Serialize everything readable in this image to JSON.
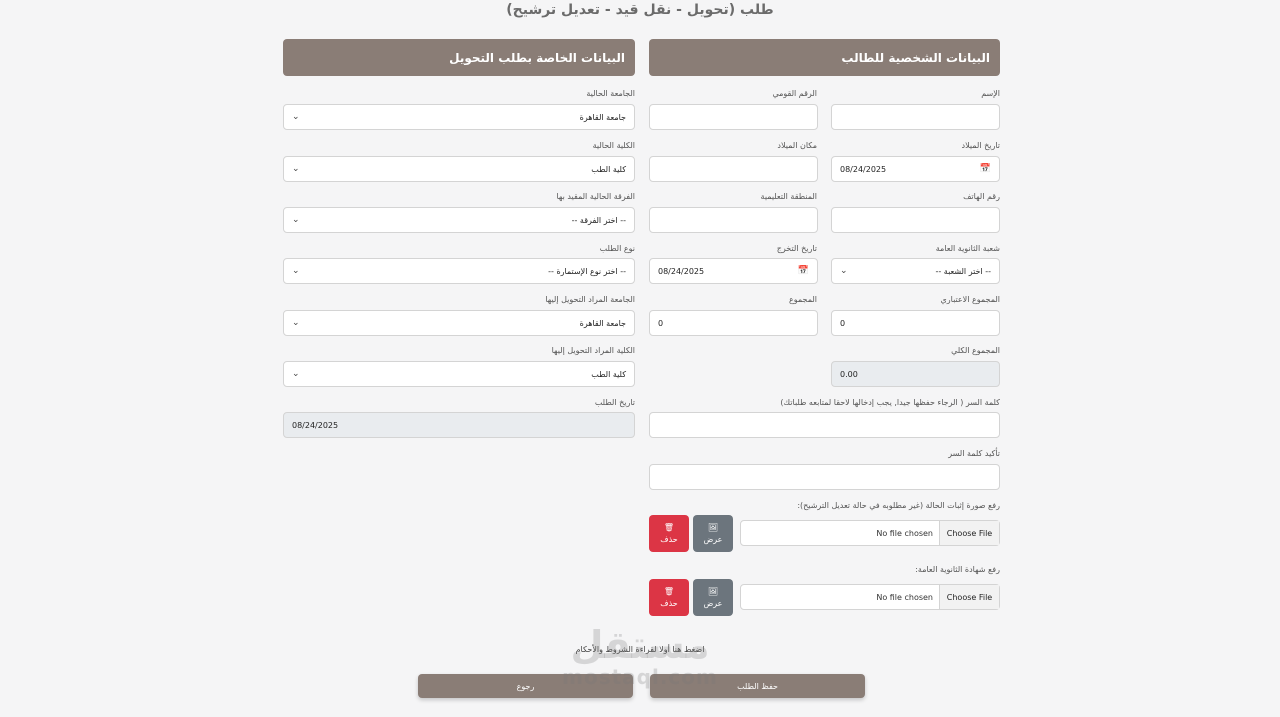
{
  "page_title": "طلب (تحويل - نقل قيد - تعديل ترشيح)",
  "personal": {
    "header": "البيانات الشخصية للطالب",
    "name_label": "الإسم",
    "name_value": "",
    "national_id_label": "الرقم القومي",
    "national_id_value": "",
    "birth_date_label": "تاريخ الميلاد",
    "birth_date_value": "08/24/2025",
    "birth_place_label": "مكان الميلاد",
    "birth_place_value": "",
    "phone_label": "رقم الهاتف",
    "phone_value": "",
    "edu_zone_label": "المنطقة التعليمية",
    "edu_zone_value": "",
    "secondary_branch_label": "شعبة الثانوية العامة",
    "secondary_branch_value": "-- اختر الشعبة --",
    "grad_date_label": "تاريخ التخرج",
    "grad_date_value": "08/24/2025",
    "virtual_total_label": "المجموع الاعتباري",
    "virtual_total_value": "0",
    "total_label": "المجموع",
    "total_value": "0",
    "grand_total_label": "المجموع الكلي",
    "grand_total_value": "0.00",
    "password_label": "كلمة السر ( الرجاء حفظها جيدا, يجب إدخالها لاحقا لمتابعه طلباتك)",
    "password_value": "",
    "confirm_password_label": "تأكيد كلمة السر",
    "confirm_password_value": "",
    "upload_status_label": "رفع صورة إثبات الحالة (غير مطلوبه في حالة تعديل الترشيح):",
    "upload_secondary_label": "رفع شهادة الثانوية العامة:",
    "choose_file": "Choose File",
    "no_file": "No file chosen",
    "view_label": "عرض",
    "delete_label": "حذف"
  },
  "transfer": {
    "header": "البيانات الخاصة بطلب التحويل",
    "current_university_label": "الجامعة الحالية",
    "current_university_value": "جامعة القاهرة",
    "current_faculty_label": "الكلية الحالية",
    "current_faculty_value": "كلية الطب",
    "current_year_label": "الفرقة الحالية المقيد بها",
    "current_year_value": "-- اختر الفرقة --",
    "request_type_label": "نوع الطلب",
    "request_type_value": "-- اختر نوع الإستمارة --",
    "target_university_label": "الجامعة المراد التحويل إليها",
    "target_university_value": "جامعة القاهرة",
    "target_faculty_label": "الكلية المراد التحويل إليها",
    "target_faculty_value": "كلية الطب",
    "request_date_label": "تاريخ الطلب",
    "request_date_value": "08/24/2025"
  },
  "footer": {
    "terms_link": "اضغط هنا أولا لقراءة الشروط والأحكام",
    "save_label": "حفظ الطلب",
    "back_label": "رجوع"
  },
  "watermark": {
    "arabic": "مستقل",
    "latin": "mostaql.com"
  },
  "icons": {
    "view": "image-icon",
    "delete": "trash-icon",
    "dropdown": "chevron-down-icon",
    "calendar": "calendar-icon"
  },
  "colors": {
    "header_bg": "#8a7d76",
    "delete_bg": "#dc3545",
    "view_bg": "#6c757d",
    "page_bg": "#f5f5f6"
  }
}
